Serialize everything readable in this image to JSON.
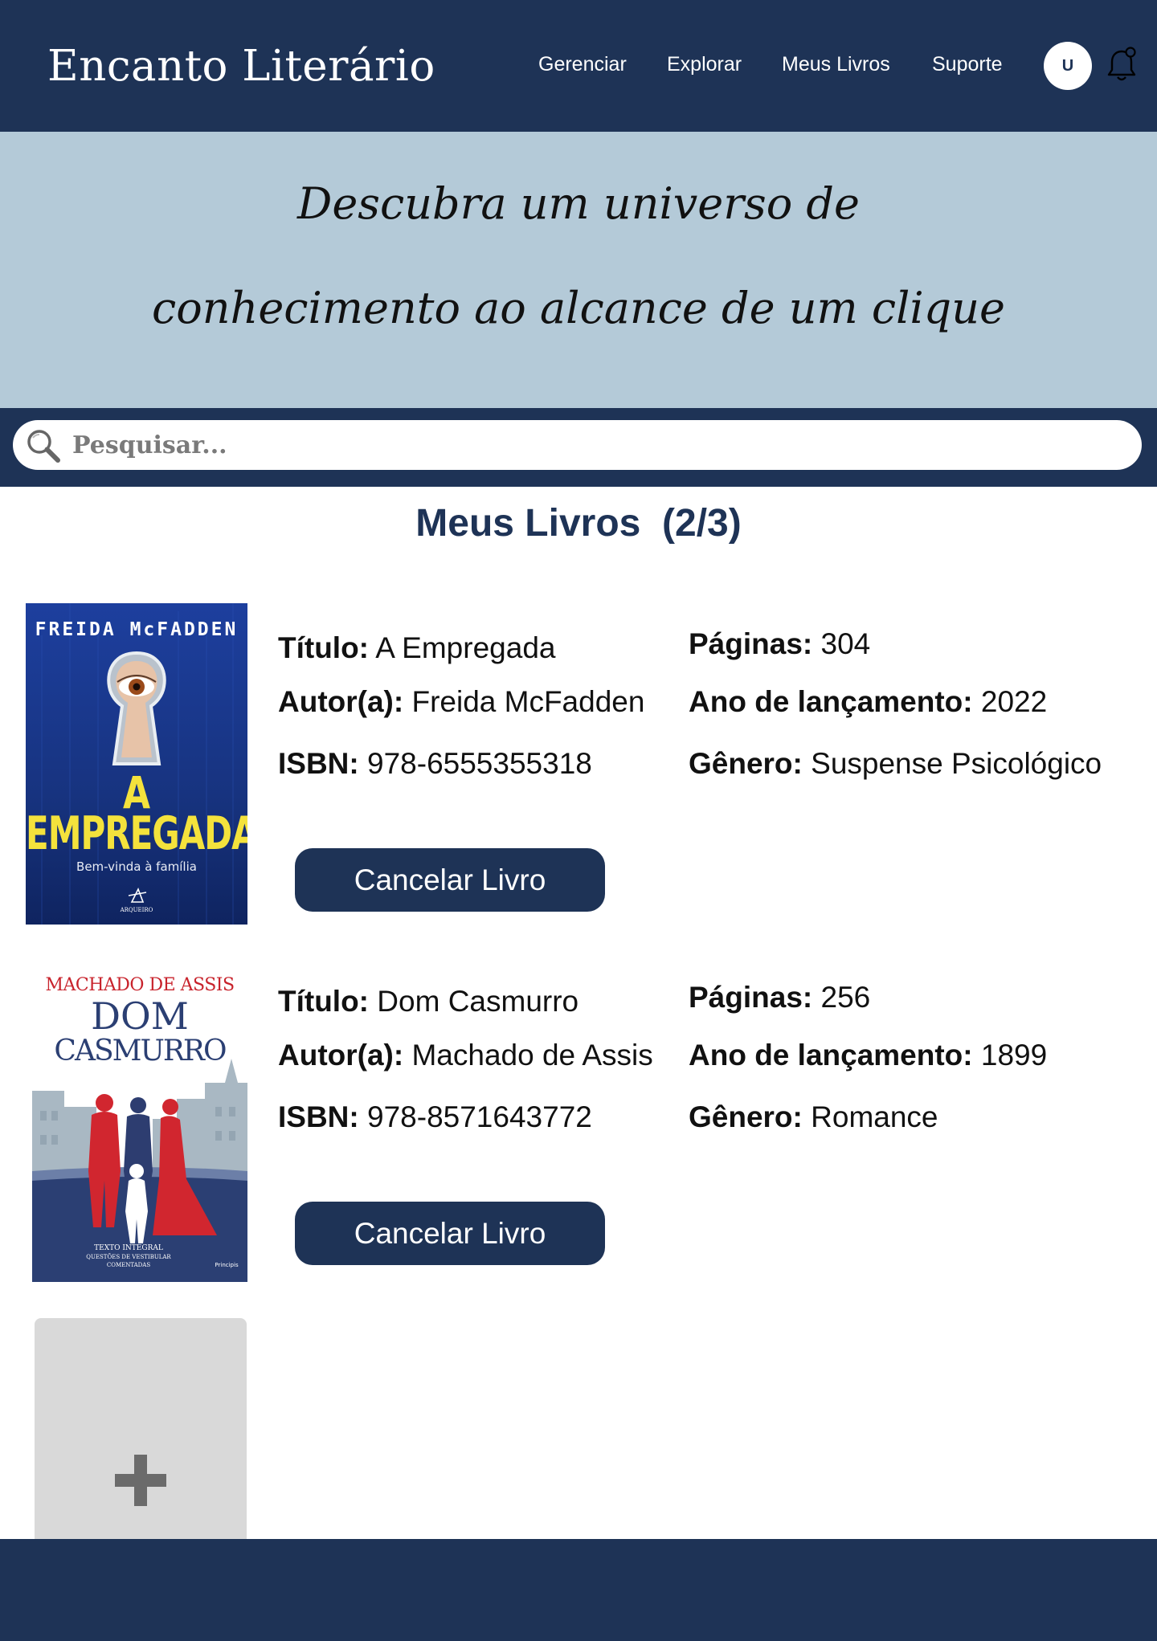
{
  "header": {
    "brand": "Encanto Literário",
    "nav": [
      "Gerenciar",
      "Explorar",
      "Meus Livros",
      "Suporte"
    ],
    "avatar_initial": "U",
    "bell_icon": "bell-icon"
  },
  "hero": {
    "line1": "Descubra um universo de",
    "line2": "conhecimento ao alcance de um clique"
  },
  "search": {
    "placeholder": "Pesquisar...",
    "value": ""
  },
  "section": {
    "title": "Meus Livros  (2/3)"
  },
  "books": [
    {
      "cover": {
        "author_line": "FREIDA McFADDEN",
        "title_small": "A",
        "title_big": "EMPREGADA",
        "tagline": "Bem-vinda à família",
        "publisher": "ARQUEIRO"
      },
      "labels": {
        "titulo": "Título:",
        "autor": "Autor(a):",
        "isbn": "ISBN:",
        "paginas": "Páginas:",
        "ano": "Ano de lançamento:",
        "genero": "Gênero:"
      },
      "titulo": "A Empregada",
      "autor": "Freida McFadden",
      "isbn": "978-6555355318",
      "paginas": "304",
      "ano": "2022",
      "genero": "Suspense Psicológico",
      "button": "Cancelar Livro"
    },
    {
      "cover": {
        "author_line": "MACHADO DE ASSIS",
        "title_l1": "DOM",
        "title_l2": "CASMURRO",
        "bottom_l1": "TEXTO INTEGRAL",
        "bottom_l2": "QUESTÕES DE VESTIBULAR",
        "bottom_l3": "COMENTADAS",
        "publisher": "Principis"
      },
      "labels": {
        "titulo": "Título:",
        "autor": "Autor(a):",
        "isbn": "ISBN:",
        "paginas": "Páginas:",
        "ano": "Ano de lançamento:",
        "genero": "Gênero:"
      },
      "titulo": "Dom Casmurro",
      "autor": "Machado de Assis",
      "isbn": "978-8571643772",
      "paginas": "256",
      "ano": "1899",
      "genero": "Romance",
      "button": "Cancelar Livro"
    }
  ],
  "add_card": {
    "icon": "plus-icon"
  },
  "colors": {
    "navy": "#1e3356",
    "hero_bg": "#b4cad8",
    "add_card_bg": "#d9d9d9",
    "plus": "#6b6b6b"
  }
}
